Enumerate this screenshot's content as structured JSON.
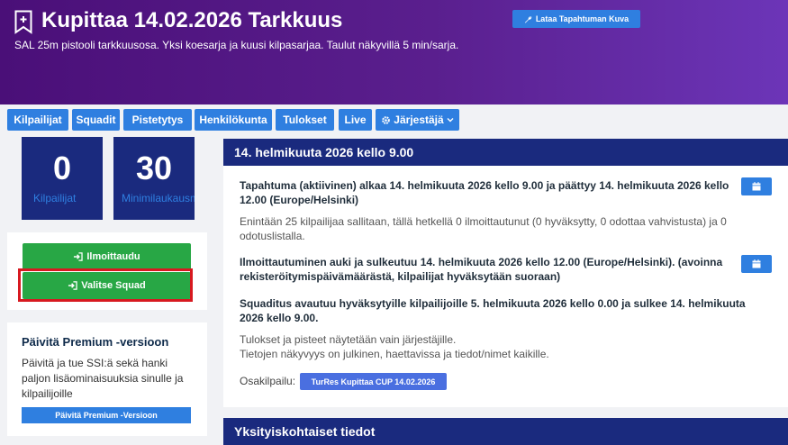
{
  "header": {
    "title": "Kupittaa 14.02.2026 Tarkkuus",
    "subtitle": "SAL 25m pistooli tarkkuusosa. Yksi koesarja ja kuusi kilpasarjaa. Taulut näkyvillä 5 min/sarja.",
    "upload_button": "Lataa Tapahtuman Kuva",
    "event_icon": "bookmark-plus-icon",
    "upload_icon": "wrench-icon"
  },
  "nav": {
    "tabs": [
      "Kilpailijat",
      "Squadit",
      "Pistetytys",
      "Henkilökunta",
      "Tulokset",
      "Live",
      "Järjestäjä"
    ],
    "organizer_icon": "gear-icon",
    "dropdown_icon": "chevron-down-icon"
  },
  "stats": {
    "competitors": {
      "value": "0",
      "label": "Kilpailijat"
    },
    "minimum": {
      "value": "30",
      "label": "Minimilaukausmäärä"
    }
  },
  "actions": {
    "register": "Ilmoittaudu",
    "select_squad": "Valitse Squad",
    "icon": "sign-in-icon"
  },
  "premium": {
    "title": "Päivitä Premium -versioon",
    "text": "Päivitä ja tue SSI:ä sekä hanki paljon lisäominaisuuksia sinulle ja kilpailijoille",
    "button": "Päivitä Premium -Versioon"
  },
  "event_panel": {
    "title": "14. helmikuuta 2026 kello 9.00",
    "schedule": "Tapahtuma (aktiivinen) alkaa 14. helmikuuta 2026 kello 9.00 ja päättyy 14. helmikuuta 2026 kello 12.00 (Europe/Helsinki)",
    "capacity": "Enintään 25 kilpailijaa sallitaan, tällä hetkellä 0 ilmoittautunut (0 hyväksytty, 0 odottaa vahvistusta) ja 0 odotuslistalla.",
    "registration": "Ilmoittautuminen auki ja sulkeutuu 14. helmikuuta 2026 kello 12.00 (Europe/Helsinki). (avoinna rekisteröitymispäivämäärästä, kilpailijat hyväksytään suoraan)",
    "squadding": "Squaditus avautuu hyväksytyille kilpailijoille 5. helmikuuta 2026 kello 0.00 ja sulkee 14. helmikuuta 2026 kello 9.00.",
    "results_visibility": "Tulokset ja pisteet näytetään vain järjestäjille.",
    "info_visibility": "Tietojen näkyvyys on julkinen, haettavissa ja tiedot/nimet kaikille.",
    "subevent_label": "Osakilpailu:",
    "subevent_button": "TurRes Kupittaa CUP 14.02.2026",
    "calendar_icon": "calendar-icon"
  },
  "details_panel": {
    "title": "Yksityiskohtaiset tiedot"
  }
}
